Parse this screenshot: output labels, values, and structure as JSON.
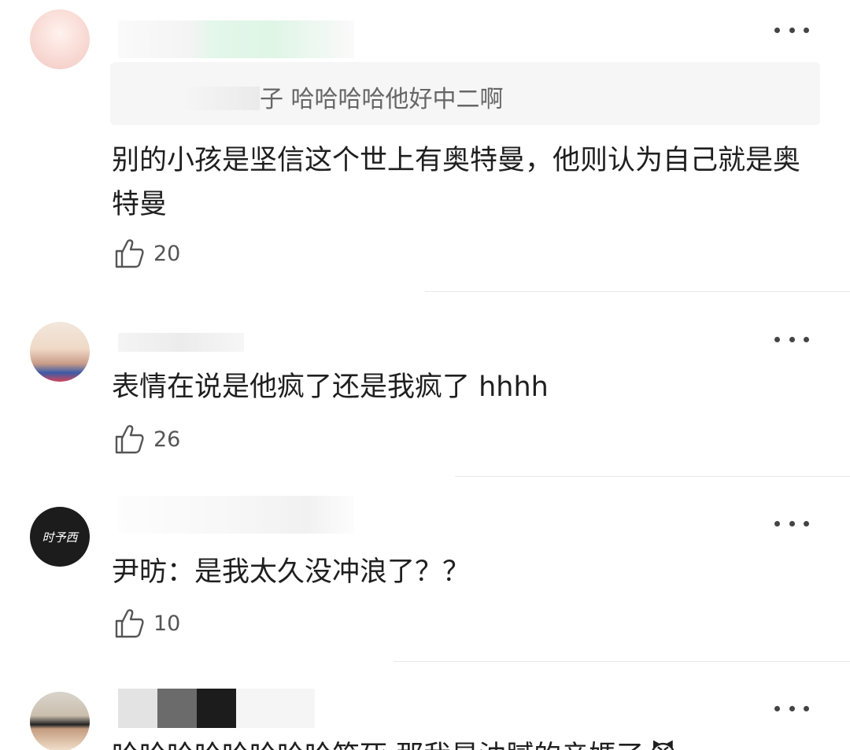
{
  "comments": [
    {
      "quote": {
        "text": "子 哈哈哈哈他好中二啊"
      },
      "text": "别的小孩是坚信这个世上有奥特曼，他则认为自己就是奥特曼",
      "likes": "20"
    },
    {
      "text": "表情在说是他疯了还是我疯了 hhhh",
      "likes": "26"
    },
    {
      "avatar_text": "时予西",
      "text": "尹昉：是我太久没冲浪了？？",
      "likes": "10"
    },
    {
      "text": "哈哈哈哈哈哈哈哈笑死 那我是油腻的亲媽了",
      "emoji": "😈"
    }
  ],
  "icons": {
    "more": "more-dots-icon",
    "like": "thumbs-up-icon"
  },
  "colors": {
    "text": "#1f1f1f",
    "secondary": "#555555",
    "quote_bg": "#f6f6f6",
    "divider": "#e8e8e8"
  }
}
